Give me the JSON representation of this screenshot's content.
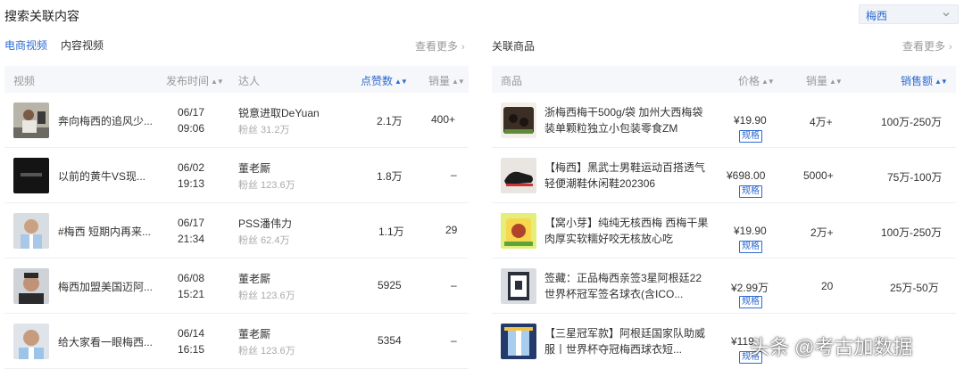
{
  "header": {
    "title": "搜索关联内容",
    "keyword": "梅西"
  },
  "video_tabs": [
    {
      "label": "电商视频",
      "active": true
    },
    {
      "label": "内容视频",
      "active": false
    }
  ],
  "more_label": "查看更多",
  "product_section": {
    "title": "关联商品"
  },
  "colors": {
    "accent": "#2e6bd1",
    "muted": "#999999",
    "header_bg": "#f5f7fa"
  },
  "video_table": {
    "columns": [
      "视频",
      "发布时间",
      "达人",
      "点赞数",
      "销量"
    ],
    "rows": [
      {
        "title": "奔向梅西的追风少...",
        "date": "06/17",
        "time": "09:06",
        "creator": "锐意进取DeYuan",
        "fans": "粉丝 31.2万",
        "likes": "2.1万",
        "sales": "400+"
      },
      {
        "title": "以前的黄牛VS现...",
        "date": "06/02",
        "time": "19:13",
        "creator": "董老厮",
        "fans": "粉丝 123.6万",
        "likes": "1.8万",
        "sales": "–"
      },
      {
        "title": "#梅西 短期内再来...",
        "date": "06/17",
        "time": "21:34",
        "creator": "PSS潘伟力",
        "fans": "粉丝 62.4万",
        "likes": "1.1万",
        "sales": "29"
      },
      {
        "title": "梅西加盟美国迈阿...",
        "date": "06/08",
        "time": "15:21",
        "creator": "董老厮",
        "fans": "粉丝 123.6万",
        "likes": "5925",
        "sales": "–"
      },
      {
        "title": "给大家看一眼梅西...",
        "date": "06/14",
        "time": "16:15",
        "creator": "董老厮",
        "fans": "粉丝 123.6万",
        "likes": "5354",
        "sales": "–"
      }
    ]
  },
  "product_table": {
    "columns": [
      "商品",
      "价格",
      "销量",
      "销售额"
    ],
    "spec_label": "规格",
    "rows": [
      {
        "title": "浙梅西梅干500g/袋 加州大西梅袋装单颗粒独立小包装零食ZM",
        "price": "¥19.90",
        "sales": "4万+",
        "revenue": "100万-250万"
      },
      {
        "title": "【梅西】黑武士男鞋运动百搭透气轻便潮鞋休闲鞋202306",
        "price": "¥698.00",
        "sales": "5000+",
        "revenue": "75万-100万"
      },
      {
        "title": "【窝小芽】纯纯无核西梅 西梅干果肉厚实软糯好咬无核放心吃",
        "price": "¥19.90",
        "sales": "2万+",
        "revenue": "100万-250万"
      },
      {
        "title": "签藏：正品梅西亲签3星阿根廷22世界杯冠军签名球衣(含ICO...",
        "price": "¥2.99万",
        "sales": "20",
        "revenue": "25万-50万"
      },
      {
        "title": "【三星冠军款】阿根廷国家队助威服丨世界杯夺冠梅西球衣短...",
        "price": "¥119.",
        "sales": "",
        "revenue": ""
      }
    ]
  },
  "watermark": "头条 @考古加数据"
}
